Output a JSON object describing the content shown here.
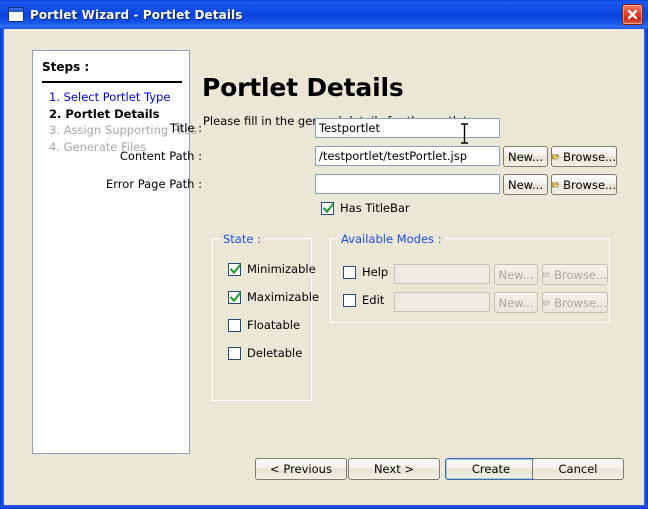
{
  "window": {
    "title": "Portlet Wizard - Portlet Details",
    "icon": "window-icon",
    "close_label": "close-icon"
  },
  "steps_panel": {
    "heading": "Steps :",
    "items": [
      {
        "label": "1. Select Portlet Type",
        "state": "done"
      },
      {
        "label": "2. Portlet Details",
        "state": "current"
      },
      {
        "label": "3. Assign Supporting Files",
        "state": "pending"
      },
      {
        "label": "4. Generate Files",
        "state": "pending"
      }
    ]
  },
  "main": {
    "title": "Portlet Details",
    "subtitle": "Please fill in the general details for the portlet.",
    "fields": [
      {
        "label": "Title :",
        "value": "Testportlet",
        "placeholder": ""
      },
      {
        "label": "Content Path :",
        "value": "/testportlet/testPortlet.jsp",
        "placeholder": ""
      },
      {
        "label": "Error Page Path :",
        "value": "",
        "placeholder": ""
      }
    ],
    "new_label": "New...",
    "browse_label": "Browse...",
    "has_titlebar": {
      "label": "Has TitleBar",
      "checked": true
    }
  },
  "state_group": {
    "legend": "State :",
    "items": [
      {
        "label": "Minimizable",
        "checked": true
      },
      {
        "label": "Maximizable",
        "checked": true
      },
      {
        "label": "Floatable",
        "checked": false
      },
      {
        "label": "Deletable",
        "checked": false
      }
    ]
  },
  "modes_group": {
    "legend": "Available Modes :",
    "rows": [
      {
        "label": "Help",
        "checked": false,
        "value": "",
        "new_label": "New...",
        "browse_label": "Browse...",
        "enabled": false
      },
      {
        "label": "Edit",
        "checked": false,
        "value": "",
        "new_label": "New...",
        "browse_label": "Browse...",
        "enabled": false
      }
    ]
  },
  "footer": {
    "previous": "< Previous",
    "next": "Next >",
    "create": "Create",
    "cancel": "Cancel"
  },
  "colors": {
    "titlebar_blue": "#0d4ae4",
    "dialog_bg": "#ebe7d7",
    "link_blue": "#0000c8",
    "legend_blue": "#1c4fd8",
    "close_red": "#e2452a",
    "check_green": "#1e9e2e",
    "focus_blue": "#3a6ea5"
  }
}
